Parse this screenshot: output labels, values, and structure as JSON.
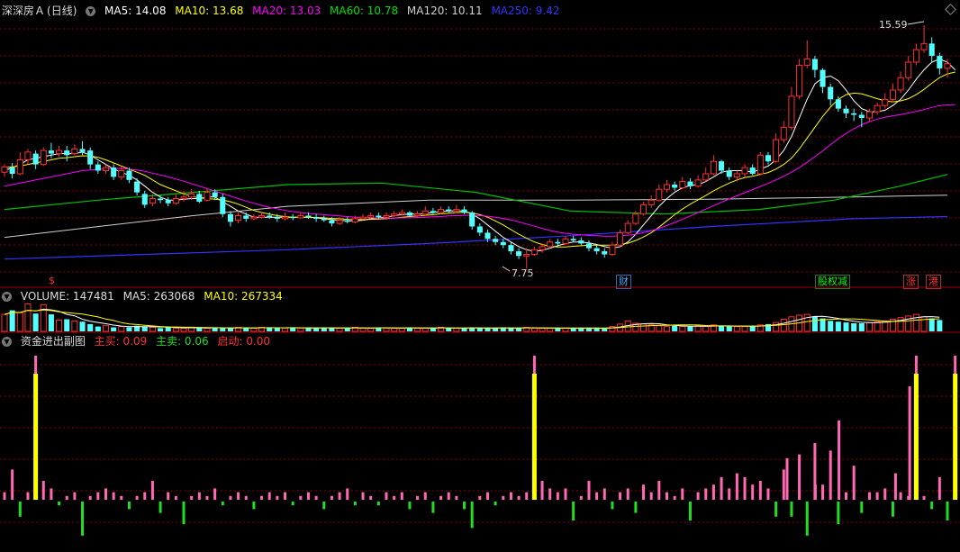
{
  "main": {
    "stock_name": "深深房Ａ",
    "period": "(日线)",
    "ma": [
      {
        "label": "MA5: 14.08",
        "color": "#ffffff"
      },
      {
        "label": "MA10: 13.68",
        "color": "#ffff00"
      },
      {
        "label": "MA20: 13.03",
        "color": "#ff00ff"
      },
      {
        "label": "MA60: 10.78",
        "color": "#00e000"
      },
      {
        "label": "MA120: 10.11",
        "color": "#d0d0d0"
      },
      {
        "label": "MA250: 9.42",
        "color": "#3333ff"
      }
    ],
    "high_label": "15.59",
    "low_label": "7.75",
    "event_tags": [
      {
        "text": "$",
        "color": "#ff3030"
      },
      {
        "text": "财",
        "color": "#44aaff"
      },
      {
        "text": "股权减",
        "color": "#00ff00"
      },
      {
        "text": "涨",
        "color": "#ff3030"
      },
      {
        "text": "港",
        "color": "#ff3030"
      }
    ]
  },
  "volume": {
    "label": "VOLUME: 147481",
    "ma5": "MA5: 263068",
    "ma10": "MA10: 267334"
  },
  "fund": {
    "title": "资金进出副图",
    "buy": "主买: 0.09",
    "sell": "主卖: 0.06",
    "start": "启动: 0.00"
  },
  "colors": {
    "up": "#ff3030",
    "down": "#54ffff",
    "grid": "#8b0000",
    "bg": "#000000",
    "buy": "#ff69b4",
    "sell": "#22dd22",
    "signal": "#ffff00"
  },
  "chart_data": {
    "type": "candlestick",
    "price_range": [
      7.75,
      15.59
    ],
    "candles": [
      [
        10.85,
        11.02,
        11.1,
        10.7
      ],
      [
        11.0,
        10.8,
        11.15,
        10.65
      ],
      [
        10.8,
        11.25,
        11.5,
        10.75
      ],
      [
        11.25,
        11.5,
        11.6,
        11.1
      ],
      [
        11.45,
        11.1,
        11.55,
        10.95
      ],
      [
        11.1,
        11.55,
        11.65,
        11.05
      ],
      [
        11.55,
        11.45,
        11.8,
        11.3
      ],
      [
        11.45,
        11.55,
        11.7,
        11.35
      ],
      [
        11.55,
        11.4,
        11.7,
        11.2
      ],
      [
        11.45,
        11.6,
        11.75,
        11.4
      ],
      [
        11.6,
        11.5,
        11.85,
        11.4
      ],
      [
        11.55,
        11.1,
        11.65,
        10.95
      ],
      [
        11.1,
        10.9,
        11.2,
        10.8
      ],
      [
        10.9,
        11.0,
        11.1,
        10.8
      ],
      [
        11.0,
        10.7,
        11.1,
        10.6
      ],
      [
        10.7,
        10.9,
        11.05,
        10.6
      ],
      [
        10.9,
        10.6,
        11.0,
        10.5
      ],
      [
        10.55,
        10.2,
        10.65,
        10.1
      ],
      [
        10.15,
        9.8,
        10.25,
        9.7
      ],
      [
        9.85,
        10.0,
        10.15,
        9.75
      ],
      [
        10.0,
        9.95,
        10.1,
        9.85
      ],
      [
        9.95,
        9.85,
        10.05,
        9.75
      ],
      [
        9.85,
        10.0,
        10.15,
        9.8
      ],
      [
        10.0,
        10.05,
        10.25,
        9.9
      ],
      [
        10.05,
        10.15,
        10.3,
        9.95
      ],
      [
        10.15,
        9.9,
        10.25,
        9.85
      ],
      [
        9.95,
        10.2,
        10.35,
        9.9
      ],
      [
        10.2,
        10.05,
        10.3,
        9.95
      ],
      [
        10.05,
        9.5,
        10.15,
        9.4
      ],
      [
        9.5,
        9.25,
        9.6,
        9.1
      ],
      [
        9.3,
        9.45,
        9.6,
        9.2
      ],
      [
        9.45,
        9.35,
        9.55,
        9.25
      ],
      [
        9.35,
        9.4,
        9.5,
        9.3
      ],
      [
        9.4,
        9.45,
        9.55,
        9.35
      ],
      [
        9.45,
        9.4,
        9.55,
        9.35
      ],
      [
        9.4,
        9.35,
        9.5,
        9.25
      ],
      [
        9.35,
        9.4,
        9.55,
        9.3
      ],
      [
        9.4,
        9.38,
        9.5,
        9.3
      ],
      [
        9.38,
        9.45,
        9.55,
        9.35
      ],
      [
        9.45,
        9.4,
        9.55,
        9.35
      ],
      [
        9.4,
        9.35,
        9.5,
        9.25
      ],
      [
        9.35,
        9.3,
        9.45,
        9.25
      ],
      [
        9.3,
        9.2,
        9.4,
        9.1
      ],
      [
        9.2,
        9.3,
        9.4,
        9.15
      ],
      [
        9.3,
        9.25,
        9.4,
        9.2
      ],
      [
        9.25,
        9.35,
        9.45,
        9.2
      ],
      [
        9.35,
        9.4,
        9.5,
        9.3
      ],
      [
        9.4,
        9.45,
        9.55,
        9.35
      ],
      [
        9.45,
        9.4,
        9.55,
        9.35
      ],
      [
        9.4,
        9.45,
        9.55,
        9.35
      ],
      [
        9.45,
        9.5,
        9.6,
        9.4
      ],
      [
        9.5,
        9.55,
        9.65,
        9.45
      ],
      [
        9.55,
        9.45,
        9.6,
        9.4
      ],
      [
        9.45,
        9.5,
        9.6,
        9.4
      ],
      [
        9.5,
        9.6,
        9.75,
        9.45
      ],
      [
        9.6,
        9.55,
        9.7,
        9.5
      ],
      [
        9.55,
        9.65,
        9.75,
        9.5
      ],
      [
        9.65,
        9.6,
        9.75,
        9.55
      ],
      [
        9.6,
        9.65,
        9.8,
        9.55
      ],
      [
        9.65,
        9.55,
        9.75,
        9.5
      ],
      [
        9.55,
        9.1,
        9.6,
        9.0
      ],
      [
        9.1,
        8.9,
        9.2,
        8.8
      ],
      [
        8.9,
        8.7,
        9.0,
        8.6
      ],
      [
        8.7,
        8.6,
        8.8,
        8.5
      ],
      [
        8.6,
        8.5,
        8.7,
        8.4
      ],
      [
        8.5,
        8.3,
        8.6,
        8.2
      ],
      [
        8.3,
        8.15,
        8.4,
        8.05
      ],
      [
        8.15,
        8.2,
        8.4,
        7.75
      ],
      [
        8.2,
        8.35,
        8.45,
        8.15
      ],
      [
        8.35,
        8.45,
        8.55,
        8.25
      ],
      [
        8.45,
        8.6,
        8.7,
        8.4
      ],
      [
        8.6,
        8.55,
        8.7,
        8.45
      ],
      [
        8.55,
        8.7,
        8.8,
        8.5
      ],
      [
        8.7,
        8.65,
        8.8,
        8.6
      ],
      [
        8.65,
        8.55,
        8.75,
        8.5
      ],
      [
        8.55,
        8.4,
        8.65,
        8.3
      ],
      [
        8.4,
        8.3,
        8.5,
        8.2
      ],
      [
        8.3,
        8.2,
        8.4,
        8.1
      ],
      [
        8.2,
        8.5,
        8.6,
        8.15
      ],
      [
        8.5,
        8.9,
        9.0,
        8.45
      ],
      [
        8.9,
        9.2,
        9.3,
        8.85
      ],
      [
        9.2,
        9.5,
        9.6,
        9.15
      ],
      [
        9.5,
        9.8,
        9.9,
        9.45
      ],
      [
        9.8,
        9.95,
        10.1,
        9.7
      ],
      [
        9.95,
        10.3,
        10.45,
        9.9
      ],
      [
        10.3,
        10.45,
        10.6,
        10.2
      ],
      [
        10.45,
        10.35,
        10.55,
        10.25
      ],
      [
        10.35,
        10.55,
        10.7,
        10.3
      ],
      [
        10.55,
        10.4,
        10.65,
        10.3
      ],
      [
        10.4,
        10.6,
        10.75,
        10.35
      ],
      [
        10.6,
        10.8,
        11.0,
        10.55
      ],
      [
        10.8,
        11.2,
        11.4,
        10.75
      ],
      [
        11.2,
        10.9,
        11.25,
        10.8
      ],
      [
        10.9,
        10.7,
        11.0,
        10.6
      ],
      [
        10.7,
        10.8,
        10.9,
        10.55
      ],
      [
        10.8,
        11.0,
        11.1,
        10.7
      ],
      [
        11.0,
        10.8,
        11.1,
        10.75
      ],
      [
        10.8,
        11.4,
        11.5,
        10.75
      ],
      [
        11.4,
        11.2,
        11.5,
        11.1
      ],
      [
        11.2,
        11.9,
        12.1,
        11.15
      ],
      [
        11.9,
        12.3,
        12.5,
        11.8
      ],
      [
        12.3,
        13.3,
        13.6,
        12.2
      ],
      [
        13.3,
        14.3,
        14.5,
        13.2
      ],
      [
        14.3,
        14.5,
        15.1,
        14.2
      ],
      [
        14.5,
        14.15,
        14.6,
        13.9
      ],
      [
        14.15,
        13.6,
        14.2,
        13.4
      ],
      [
        13.6,
        13.2,
        13.7,
        13.0
      ],
      [
        13.2,
        12.9,
        13.3,
        12.8
      ],
      [
        12.9,
        12.75,
        13.0,
        12.6
      ],
      [
        12.75,
        12.7,
        12.9,
        12.5
      ],
      [
        12.7,
        12.6,
        12.8,
        12.3
      ],
      [
        12.6,
        12.8,
        12.9,
        12.5
      ],
      [
        12.8,
        13.0,
        13.1,
        12.7
      ],
      [
        13.0,
        13.2,
        13.4,
        12.9
      ],
      [
        13.2,
        13.5,
        13.7,
        13.1
      ],
      [
        13.5,
        13.9,
        14.1,
        13.4
      ],
      [
        13.9,
        14.4,
        14.6,
        13.8
      ],
      [
        14.4,
        14.8,
        15.0,
        14.3
      ],
      [
        14.8,
        15.0,
        15.59,
        14.7
      ],
      [
        15.0,
        14.6,
        15.2,
        14.4
      ],
      [
        14.6,
        14.2,
        14.7,
        14.0
      ],
      [
        14.2,
        14.35,
        14.5,
        13.9
      ]
    ],
    "ma_lines": {
      "MA5": [
        10.9,
        11.0,
        11.1,
        11.25,
        11.3,
        11.35,
        11.4,
        11.45,
        11.45,
        11.45,
        11.5,
        11.4,
        11.25,
        11.1,
        10.95,
        10.85,
        10.75,
        10.6,
        10.4,
        10.2,
        10.05,
        9.95,
        9.95,
        9.98,
        10.0,
        10.0,
        10.05,
        10.05,
        9.9,
        9.75,
        9.6,
        9.5,
        9.4,
        9.4,
        9.4,
        9.4,
        9.4,
        9.4,
        9.4,
        9.4,
        9.38,
        9.35,
        9.32,
        9.3,
        9.28,
        9.28,
        9.3,
        9.35,
        9.38,
        9.4,
        9.45,
        9.48,
        9.5,
        9.5,
        9.52,
        9.55,
        9.58,
        9.6,
        9.6,
        9.6,
        9.5,
        9.35,
        9.15,
        8.95,
        8.75,
        8.6,
        8.45,
        8.35,
        8.3,
        8.33,
        8.4,
        8.48,
        8.55,
        8.6,
        8.6,
        8.57,
        8.52,
        8.45,
        8.4,
        8.45,
        8.6,
        8.85,
        9.15,
        9.45,
        9.75,
        10.0,
        10.2,
        10.35,
        10.42,
        10.45,
        10.55,
        10.7,
        10.85,
        10.9,
        10.9,
        10.9,
        10.85,
        10.95,
        11.05,
        11.25,
        11.55,
        12.0,
        12.6,
        13.2,
        13.7,
        13.9,
        13.95,
        13.8,
        13.5,
        13.15,
        12.9,
        12.8,
        12.8,
        12.85,
        13.0,
        13.2,
        13.5,
        13.85,
        14.15,
        14.4,
        14.5,
        14.4,
        14.15
      ],
      "MA10": [
        11.0,
        11.02,
        11.05,
        11.1,
        11.15,
        11.2,
        11.25,
        11.3,
        11.32,
        11.35,
        11.38,
        11.37,
        11.33,
        11.25,
        11.15,
        11.05,
        10.95,
        10.85,
        10.75,
        10.6,
        10.45,
        10.35,
        10.25,
        10.15,
        10.08,
        10.02,
        10.0,
        9.98,
        9.95,
        9.9,
        9.82,
        9.72,
        9.62,
        9.55,
        9.5,
        9.45,
        9.42,
        9.4,
        9.4,
        9.4,
        9.39,
        9.38,
        9.36,
        9.35,
        9.33,
        9.32,
        9.32,
        9.33,
        9.34,
        9.35,
        9.37,
        9.4,
        9.42,
        9.44,
        9.46,
        9.48,
        9.51,
        9.53,
        9.55,
        9.56,
        9.54,
        9.48,
        9.4,
        9.28,
        9.15,
        9.0,
        8.85,
        8.72,
        8.6,
        8.52,
        8.46,
        8.44,
        8.44,
        8.46,
        8.48,
        8.5,
        8.5,
        8.5,
        8.5,
        8.52,
        8.56,
        8.65,
        8.76,
        8.9,
        9.08,
        9.28,
        9.48,
        9.66,
        9.82,
        9.96,
        10.1,
        10.25,
        10.38,
        10.5,
        10.6,
        10.68,
        10.72,
        10.78,
        10.84,
        10.95,
        11.1,
        11.3,
        11.6,
        11.95,
        12.3,
        12.65,
        12.95,
        13.2,
        13.35,
        13.4,
        13.38,
        13.3,
        13.22,
        13.15,
        13.12,
        13.15,
        13.22,
        13.35,
        13.52,
        13.72,
        13.9,
        14.02,
        14.08
      ],
      "MA20": [
        10.4,
        10.45,
        10.5,
        10.55,
        10.6,
        10.65,
        10.7,
        10.75,
        10.8,
        10.85,
        10.9,
        10.92,
        10.94,
        10.96,
        10.97,
        10.97,
        10.95,
        10.92,
        10.88,
        10.82,
        10.76,
        10.7,
        10.63,
        10.56,
        10.48,
        10.4,
        10.32,
        10.24,
        10.16,
        10.08,
        10.0,
        9.92,
        9.85,
        9.78,
        9.72,
        9.67,
        9.62,
        9.58,
        9.55,
        9.52,
        9.5,
        9.48,
        9.46,
        9.44,
        9.42,
        9.4,
        9.39,
        9.38,
        9.37,
        9.37,
        9.37,
        9.38,
        9.38,
        9.39,
        9.4,
        9.41,
        9.42,
        9.44,
        9.45,
        9.46,
        9.46,
        9.45,
        9.43,
        9.4,
        9.36,
        9.31,
        9.25,
        9.18,
        9.11,
        9.04,
        8.97,
        8.92,
        8.88,
        8.85,
        8.83,
        8.81,
        8.8,
        8.79,
        8.79,
        8.8,
        8.82,
        8.85,
        8.9,
        8.96,
        9.04,
        9.13,
        9.23,
        9.33,
        9.44,
        9.55,
        9.66,
        9.77,
        9.88,
        9.99,
        10.09,
        10.19,
        10.29,
        10.39,
        10.49,
        10.6,
        10.72,
        10.85,
        11.0,
        11.17,
        11.35,
        11.54,
        11.74,
        11.93,
        12.1,
        12.25,
        12.38,
        12.48,
        12.56,
        12.62,
        12.67,
        12.71,
        12.76,
        12.81,
        12.87,
        12.94,
        13.0,
        13.02,
        13.03
      ]
    },
    "volume": [
      2.1,
      2.6,
      2.3,
      3.4,
      2.2,
      3.3,
      2.1,
      1.4,
      1.5,
      1.3,
      1.2,
      0.9,
      0.6,
      0.7,
      0.5,
      0.6,
      0.5,
      0.7,
      0.6,
      0.5,
      0.4,
      0.5,
      0.4,
      0.4,
      0.5,
      0.4,
      0.4,
      0.5,
      0.4,
      0.4,
      0.5,
      0.4,
      0.4,
      0.5,
      0.5,
      0.4,
      0.4,
      0.5,
      0.4,
      0.4,
      0.4,
      0.5,
      0.4,
      0.4,
      0.4,
      0.5,
      0.4,
      0.4,
      0.5,
      0.4,
      0.4,
      0.4,
      0.5,
      0.4,
      0.4,
      0.4,
      0.5,
      0.4,
      0.4,
      0.4,
      0.5,
      0.4,
      0.4,
      0.4,
      0.5,
      0.4,
      0.4,
      0.5,
      0.4,
      0.4,
      0.4,
      0.4,
      0.4,
      0.4,
      0.4,
      0.4,
      0.4,
      0.4,
      0.6,
      0.9,
      1.3,
      1.0,
      0.9,
      0.8,
      0.7,
      0.6,
      0.7,
      0.6,
      0.6,
      0.7,
      0.6,
      0.8,
      0.7,
      0.6,
      0.6,
      0.6,
      0.7,
      0.8,
      0.9,
      1.1,
      1.5,
      1.8,
      2.0,
      2.1,
      1.8,
      1.6,
      1.3,
      1.2,
      1.1,
      1.0,
      1.0,
      1.1,
      1.2,
      1.3,
      1.5,
      1.7,
      1.9,
      2.1,
      1.8,
      1.6,
      1.4
    ],
    "fund_flow": [
      0.02,
      0.08,
      -0.04,
      0.02,
      0.35,
      0.05,
      0.03,
      -0.01,
      0.01,
      0.02,
      -0.09,
      0.01,
      0.02,
      0.03,
      0.02,
      0.01,
      -0.02,
      0.01,
      0.02,
      0.05,
      -0.03,
      0.02,
      0.01,
      -0.06,
      0.01,
      0.02,
      0.01,
      0.03,
      -0.01,
      0.01,
      0.02,
      0.01,
      -0.02,
      0.01,
      0.02,
      0.01,
      0.02,
      -0.01,
      0.01,
      0.02,
      0.01,
      -0.02,
      0.01,
      0.02,
      0.03,
      -0.01,
      0.02,
      0.01,
      -0.01,
      0.02,
      0.01,
      0.02,
      -0.02,
      0.01,
      0.02,
      -0.03,
      0.01,
      0.02,
      0.01,
      -0.02,
      -0.07,
      0.01,
      0.02,
      -0.01,
      0.01,
      0.02,
      0.01,
      0.02,
      0.35,
      0.05,
      0.03,
      0.02,
      0.03,
      -0.05,
      0.01,
      0.05,
      0.02,
      0.03,
      -0.02,
      0.02,
      0.03,
      -0.03,
      0.04,
      0.02,
      0.05,
      0.02,
      0.01,
      0.03,
      -0.05,
      0.02,
      0.03,
      0.04,
      0.06,
      0.03,
      0.07,
      0.06,
      0.04,
      0.05,
      0.03,
      -0.04,
      0.08,
      -0.04,
      0.12,
      -0.09,
      0.15,
      0.04,
      0.13,
      -0.06,
      0.02,
      0.09,
      -0.03,
      0.02,
      0.02,
      0.03,
      -0.04,
      0.02,
      0.01,
      0.35,
      0.01,
      -0.02,
      0.06,
      -0.05,
      0.38,
      0.03,
      -0.06,
      0.06,
      -0.06
    ]
  }
}
